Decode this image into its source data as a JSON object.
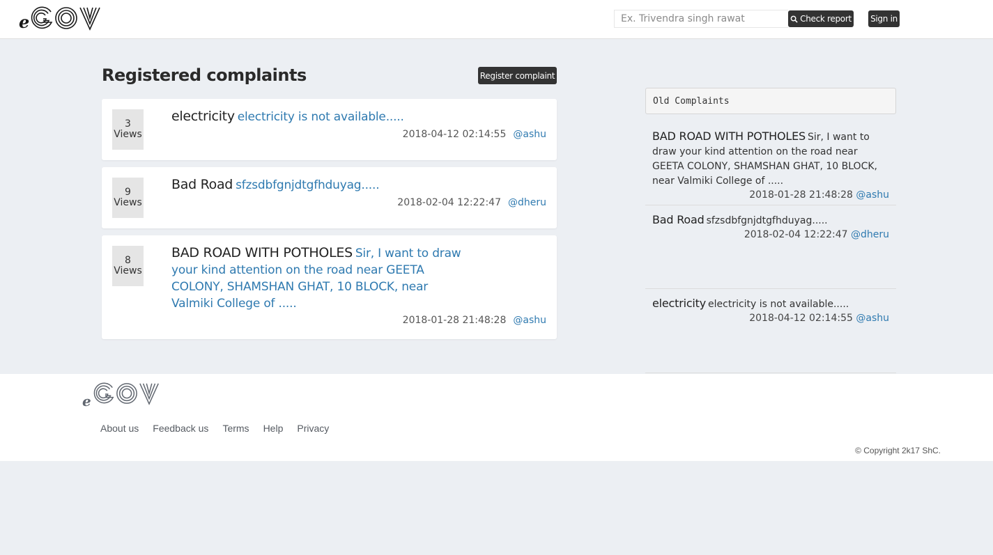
{
  "header": {
    "logo_e": "e",
    "logo_word": "GOV",
    "search_placeholder": "Ex. Trivendra singh rawat",
    "check_report_label": "Check report",
    "sign_in_label": "Sign in"
  },
  "main": {
    "title": "Registered complaints",
    "register_label": "Register complaint",
    "views_label": "Views",
    "complaints": [
      {
        "views": "3",
        "title": "electricity",
        "description": "electricity is not available.....",
        "date": "2018-04-12 02:14:55",
        "user": "@ashu"
      },
      {
        "views": "9",
        "title": "Bad Road",
        "description": "sfzsdbfgnjdtgfhduyag.....",
        "date": "2018-02-04 12:22:47",
        "user": "@dheru"
      },
      {
        "views": "8",
        "title": "BAD ROAD WITH POTHOLES",
        "description": "Sir, I want to draw your kind attention on the road near GEETA COLONY, SHAMSHAN GHAT, 10 BLOCK, near Valmiki College of .....",
        "date": "2018-01-28 21:48:28",
        "user": "@ashu"
      }
    ]
  },
  "sidebar": {
    "heading": "Old Complaints",
    "items": [
      {
        "title": "BAD ROAD WITH POTHOLES",
        "description": "Sir, I want to draw your kind attention on the road near GEETA COLONY, SHAMSHAN GHAT, 10 BLOCK, near Valmiki College of .....",
        "date": "2018-01-28 21:48:28",
        "user": "@ashu"
      },
      {
        "title": "Bad Road",
        "description": "sfzsdbfgnjdtgfhduyag.....",
        "date": "2018-02-04 12:22:47",
        "user": "@dheru"
      },
      {
        "title": "electricity",
        "description": "electricity is not available.....",
        "date": "2018-04-12 02:14:55",
        "user": "@ashu"
      }
    ]
  },
  "footer": {
    "logo_e": "e",
    "logo_word": "GOV",
    "links": [
      "About us",
      "Feedback us",
      "Terms",
      "Help",
      "Privacy"
    ],
    "copyright": "©  Copyright 2k17 ShC."
  },
  "colors": {
    "accent_link": "#2f7ab0",
    "button_dark": "#333333",
    "page_bg": "#eceff3"
  },
  "icons": {
    "check_report": "search-icon"
  }
}
